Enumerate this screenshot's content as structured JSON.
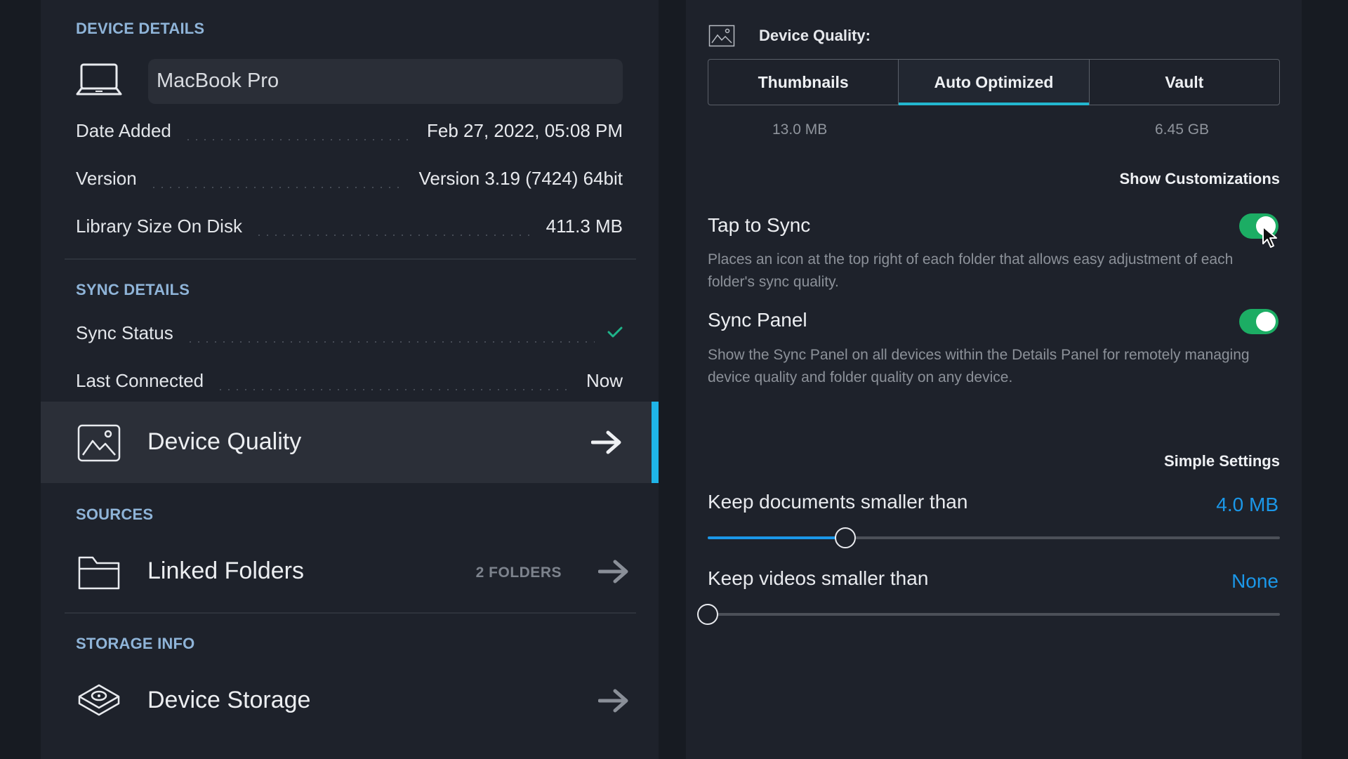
{
  "device_details": {
    "section_title": "DEVICE DETAILS",
    "device_name": "MacBook Pro",
    "rows": [
      {
        "label": "Date Added",
        "value": "Feb 27, 2022, 05:08 PM"
      },
      {
        "label": "Version",
        "value": "Version 3.19 (7424) 64bit"
      },
      {
        "label": "Library Size On Disk",
        "value": "411.3 MB"
      }
    ]
  },
  "sync_details": {
    "section_title": "SYNC DETAILS",
    "status_label": "Sync Status",
    "status_icon": "checkmark-icon",
    "last_connected_label": "Last Connected",
    "last_connected_value": "Now"
  },
  "nav": {
    "device_quality": "Device Quality",
    "sources_title": "SOURCES",
    "linked_folders": "Linked Folders",
    "linked_folders_badge": "2 FOLDERS",
    "storage_title": "STORAGE INFO",
    "device_storage": "Device Storage"
  },
  "quality": {
    "title": "Device Quality:",
    "tabs": [
      "Thumbnails",
      "Auto Optimized",
      "Vault"
    ],
    "selected_tab": "Auto Optimized",
    "sizes": {
      "thumbnails": "13.0 MB",
      "vault": "6.45 GB"
    },
    "show_customizations": "Show Customizations",
    "tap_to_sync": {
      "title": "Tap to Sync",
      "description": "Places an icon at the top right of each folder that allows easy adjustment of each folder's sync quality.",
      "enabled": true
    },
    "sync_panel": {
      "title": "Sync Panel",
      "description": "Show the Sync Panel on all devices within the Details Panel for remotely managing device quality and folder quality on any device.",
      "enabled": true
    },
    "simple_settings": "Simple Settings",
    "documents": {
      "label": "Keep documents smaller than",
      "value": "4.0 MB",
      "level": 0.24
    },
    "videos": {
      "label": "Keep videos smaller than",
      "value": "None",
      "level": 0
    }
  },
  "colors": {
    "accent_blue": "#1b97e8",
    "accent_cyan": "#1fb4e8",
    "toggle_green": "#1cad64",
    "section_title": "#8fb4d8"
  }
}
